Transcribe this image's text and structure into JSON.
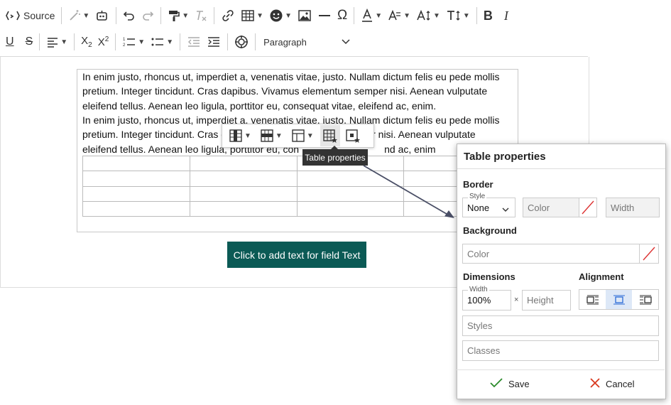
{
  "toolbar": {
    "source_label": "Source",
    "paragraph_label": "Paragraph"
  },
  "content": {
    "paragraph": "In enim justo, rhoncus ut, imperdiet a, venenatis vitae, justo. Nullam dictum felis eu pede mollis pretium. Integer tincidunt. Cras dapibus. Vivamus elementum semper nisi. Aenean vulputate eleifend tellus. Aenean leo ligula, porttitor eu, consequat vitae, eleifend ac, enim.",
    "paragraph2_fragments": {
      "a": "In enim justo, rhoncus ut, imperdiet a, venenatis vitae, justo. Nullam dictum felis eu pede mollis",
      "b": "pretium. Integer tincidunt. Cras d",
      "c": "r nisi. Aenean vulputate",
      "d": "eleifend tellus. Aenean leo ligula, porttitor eu, con",
      "e": "nd ac, enim"
    },
    "field_button": "Click to add text for field Text"
  },
  "table_toolbar": {
    "tooltip": "Table properties"
  },
  "table_properties": {
    "title": "Table properties",
    "border": {
      "heading": "Border",
      "style_label": "Style",
      "style_value": "None",
      "color_placeholder": "Color",
      "width_placeholder": "Width"
    },
    "background": {
      "heading": "Background",
      "color_placeholder": "Color"
    },
    "dimensions": {
      "heading": "Dimensions",
      "width_label": "Width",
      "width_value": "100%",
      "times": "×",
      "height_placeholder": "Height"
    },
    "alignment": {
      "heading": "Alignment",
      "selected": "center"
    },
    "styles_placeholder": "Styles",
    "classes_placeholder": "Classes",
    "save_label": "Save",
    "cancel_label": "Cancel"
  },
  "colors": {
    "field_button_bg": "#0b5a55",
    "save_check": "#2a8a2a",
    "cancel_x": "#d9381e",
    "selected_align_bg": "#dde8f7"
  }
}
